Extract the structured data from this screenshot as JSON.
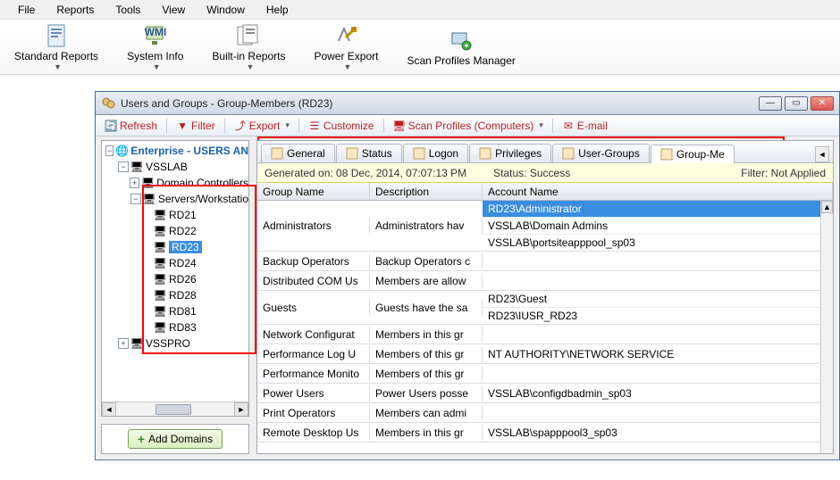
{
  "menu": [
    "File",
    "Reports",
    "Tools",
    "View",
    "Window",
    "Help"
  ],
  "ribbon": [
    {
      "id": "standard-reports",
      "label": "Standard Reports"
    },
    {
      "id": "system-info",
      "label": "System Info"
    },
    {
      "id": "builtin-reports",
      "label": "Built-in Reports"
    },
    {
      "id": "power-export",
      "label": "Power Export"
    },
    {
      "id": "scan-profiles-manager",
      "label": "Scan Profiles Manager"
    }
  ],
  "window": {
    "title": "Users and Groups - Group-Members (RD23)"
  },
  "toolbar": [
    {
      "id": "refresh",
      "label": "Refresh"
    },
    {
      "id": "filter",
      "label": "Filter"
    },
    {
      "id": "export",
      "label": "Export"
    },
    {
      "id": "customize",
      "label": "Customize"
    },
    {
      "id": "scan-profiles",
      "label": "Scan Profiles (Computers)"
    },
    {
      "id": "email",
      "label": "E-mail"
    }
  ],
  "tree": {
    "root": "Enterprise - USERS AN",
    "vss": "VSSLAB",
    "dc": "Domain Controllers",
    "sw": "Servers/Workstatio",
    "nodes": [
      "RD21",
      "RD22",
      "RD23",
      "RD24",
      "RD26",
      "RD28",
      "RD81",
      "RD83"
    ],
    "vsspro": "VSSPRO",
    "selected": "RD23",
    "add_button": "Add Domains"
  },
  "tabs": [
    {
      "id": "general",
      "label": "General"
    },
    {
      "id": "status",
      "label": "Status"
    },
    {
      "id": "logon",
      "label": "Logon"
    },
    {
      "id": "privileges",
      "label": "Privileges"
    },
    {
      "id": "user-groups",
      "label": "User-Groups"
    },
    {
      "id": "group-members",
      "label": "Group-Me",
      "active": true
    }
  ],
  "infobar": {
    "generated": "Generated on: 08 Dec, 2014, 07:07:13 PM",
    "status": "Status: Success",
    "filter": "Filter: Not Applied"
  },
  "grid": {
    "headers": [
      "Group Name",
      "Description",
      "Account Name"
    ],
    "rows": [
      {
        "group": "Administrators",
        "desc": "Administrators hav",
        "accts": [
          {
            "v": "RD23\\Administrator",
            "sel": true
          },
          {
            "v": "VSSLAB\\Domain Admins"
          },
          {
            "v": "VSSLAB\\portsiteapppool_sp03"
          }
        ]
      },
      {
        "group": "Backup Operators",
        "desc": "Backup Operators c",
        "accts": []
      },
      {
        "group": "Distributed COM Us",
        "desc": "Members are allow",
        "accts": []
      },
      {
        "group": "Guests",
        "desc": "Guests have the sa",
        "accts": [
          {
            "v": "RD23\\Guest"
          },
          {
            "v": "RD23\\IUSR_RD23"
          }
        ]
      },
      {
        "group": "Network Configurat",
        "desc": "Members in this gr",
        "accts": []
      },
      {
        "group": "Performance Log U",
        "desc": "Members of this gr",
        "accts": [
          {
            "v": "NT AUTHORITY\\NETWORK SERVICE"
          }
        ]
      },
      {
        "group": "Performance Monito",
        "desc": "Members of this gr",
        "accts": []
      },
      {
        "group": "Power Users",
        "desc": "Power Users posse",
        "accts": [
          {
            "v": "VSSLAB\\configdbadmin_sp03"
          }
        ]
      },
      {
        "group": "Print Operators",
        "desc": "Members can admi",
        "accts": []
      },
      {
        "group": "Remote Desktop Us",
        "desc": "Members in this gr",
        "accts": [
          {
            "v": "VSSLAB\\spapppool3_sp03"
          }
        ]
      }
    ]
  }
}
